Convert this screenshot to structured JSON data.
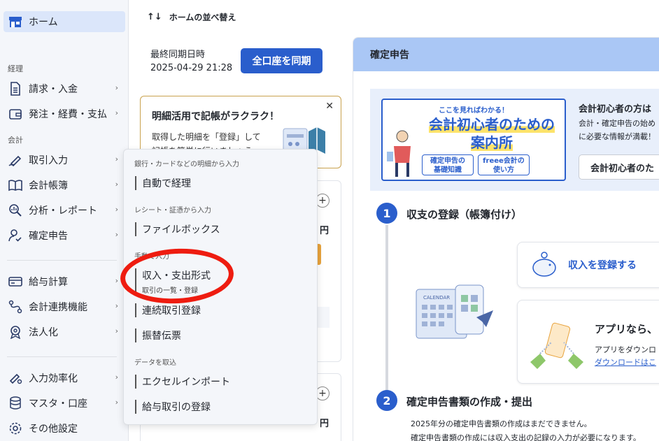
{
  "sidebar": {
    "home": "ホーム",
    "sections": {
      "accounting": "経理",
      "bookkeeping": "会計"
    },
    "items": [
      {
        "label": "請求・入金",
        "icon": "document-icon"
      },
      {
        "label": "発注・経費・支払",
        "icon": "wallet-icon"
      },
      {
        "label": "取引入力",
        "icon": "pen-icon"
      },
      {
        "label": "会計帳簿",
        "icon": "book-icon"
      },
      {
        "label": "分析・レポート",
        "icon": "analysis-icon"
      },
      {
        "label": "確定申告",
        "icon": "person-check-icon"
      },
      {
        "label": "給与計算",
        "icon": "card-icon"
      },
      {
        "label": "会計連携機能",
        "icon": "link-icon"
      },
      {
        "label": "法人化",
        "icon": "badge-icon"
      },
      {
        "label": "入力効率化",
        "icon": "pen-gear-icon"
      },
      {
        "label": "マスタ・口座",
        "icon": "database-icon"
      },
      {
        "label": "その他設定",
        "icon": "gear-icon"
      }
    ]
  },
  "header": {
    "reorder": "ホームの並べ替え"
  },
  "sync": {
    "label": "最終同期日時",
    "datetime": "2025-04-29 21:28",
    "button": "全口座を同期"
  },
  "tip": {
    "title": "明細活用で記帳がラクラク！",
    "line1": "取得した明細を「登録」して",
    "line2": "記帳を簡単に行いましょう"
  },
  "cards": {
    "yen": "円",
    "plus": "+"
  },
  "panel": {
    "title": "確定申告",
    "banner": {
      "top": "ここを見ればわかる！",
      "line1": "会計初心者のための",
      "line2": "案内所",
      "pill1a": "確定申告の",
      "pill1b": "基礎知識",
      "pill2a": "freee会計の",
      "pill2b": "使い方"
    },
    "guide_title": "会計初心者の方は",
    "guide_desc1": "会計・確定申告の始め",
    "guide_desc2": "に必要な情報が満載！",
    "guide_button": "会計初心者のた",
    "step1": {
      "num": "1",
      "title": "収支の登録（帳簿付け）"
    },
    "income": "収入を登録する",
    "calendar": "CALENDAR",
    "app_title": "アプリなら、",
    "app_desc": "アプリをダウンロ",
    "app_link": "ダウンロードはこ",
    "step2": {
      "num": "2",
      "title": "確定申告書類の作成・提出"
    },
    "step2_line1": "2025年分の確定申告書類の作成はまだできません。",
    "step2_line2": "確定申告書類の作成には収入支出の記録の入力が必要になります。"
  },
  "menu": {
    "sec1": "銀行・カードなどの明細から入力",
    "auto": "自動で経理",
    "sec2": "レシート・証憑から入力",
    "filebox": "ファイルボックス",
    "sec3": "手動で入力",
    "income_expense": "収入・支出形式",
    "income_expense_sub": "取引の一覧・登録",
    "continuous": "連続取引登録",
    "transfer": "振替伝票",
    "sec4": "データを取込",
    "excel": "エクセルインポート",
    "payroll": "給与取引の登録"
  },
  "colors": {
    "accent": "#2a5ecc",
    "panel_header": "#aac7f5",
    "annotation": "#ee1c10"
  }
}
